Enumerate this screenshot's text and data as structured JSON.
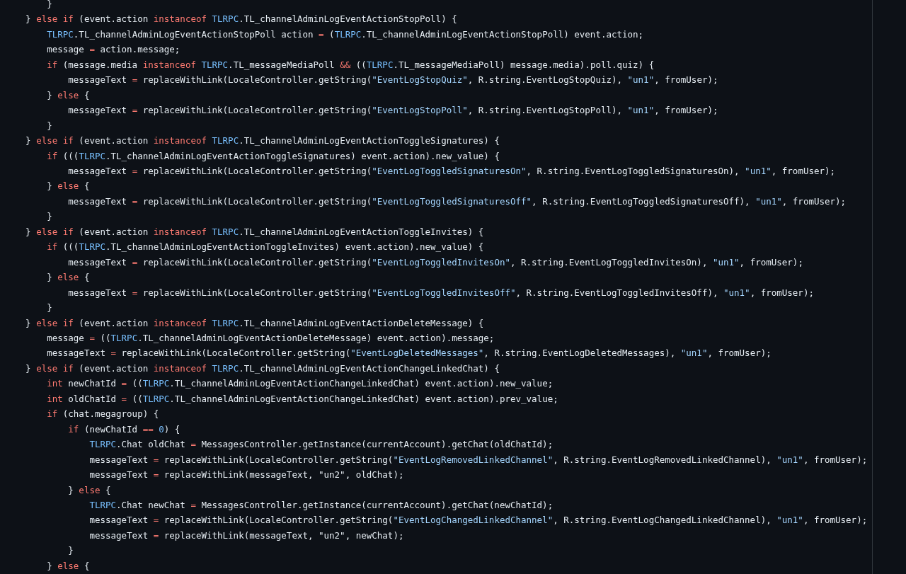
{
  "code": {
    "lines": [
      [
        {
          "text": "        }",
          "kind": "plain"
        }
      ],
      [
        {
          "text": "    } ",
          "kind": "plain"
        },
        {
          "text": "else",
          "kind": "keyword"
        },
        {
          "text": " if",
          "kind": "keyword"
        },
        {
          "text": " (event.action ",
          "kind": "plain"
        },
        {
          "text": "instanceof",
          "kind": "keyword"
        },
        {
          "text": " TLRPC",
          "kind": "type"
        },
        {
          "text": ".TL_channelAdminLogEventActionStopPoll) {",
          "kind": "plain"
        }
      ],
      [
        {
          "text": "        TLRPC",
          "kind": "type"
        },
        {
          "text": ".TL_channelAdminLogEventActionStopPoll action ",
          "kind": "plain"
        },
        {
          "text": "=",
          "kind": "operator"
        },
        {
          "text": " (",
          "kind": "plain"
        },
        {
          "text": "TLRPC",
          "kind": "type"
        },
        {
          "text": ".TL_channelAdminLogEventActionStopPoll) event.action;",
          "kind": "plain"
        }
      ],
      [
        {
          "text": "        message ",
          "kind": "plain"
        },
        {
          "text": "=",
          "kind": "operator"
        },
        {
          "text": " action.message;",
          "kind": "plain"
        }
      ],
      [
        {
          "text": "        if",
          "kind": "keyword"
        },
        {
          "text": " (message.media ",
          "kind": "plain"
        },
        {
          "text": "instanceof",
          "kind": "keyword"
        },
        {
          "text": " TLRPC",
          "kind": "type"
        },
        {
          "text": ".TL_messageMediaPoll ",
          "kind": "plain"
        },
        {
          "text": "&&",
          "kind": "operator"
        },
        {
          "text": " ((",
          "kind": "plain"
        },
        {
          "text": "TLRPC",
          "kind": "type"
        },
        {
          "text": ".TL_messageMediaPoll) message.media).poll.quiz) {",
          "kind": "plain"
        }
      ],
      [
        {
          "text": "            messageText ",
          "kind": "plain"
        },
        {
          "text": "=",
          "kind": "operator"
        },
        {
          "text": " replaceWithLink(LocaleController.getString(",
          "kind": "plain"
        },
        {
          "text": "\"EventLogStopQuiz\"",
          "kind": "string"
        },
        {
          "text": ", R.string.EventLogStopQuiz), ",
          "kind": "plain"
        },
        {
          "text": "\"un1\"",
          "kind": "string"
        },
        {
          "text": ", fromUser);",
          "kind": "plain"
        }
      ],
      [
        {
          "text": "        } ",
          "kind": "plain"
        },
        {
          "text": "else",
          "kind": "keyword"
        },
        {
          "text": " {",
          "kind": "plain"
        }
      ],
      [
        {
          "text": "            messageText ",
          "kind": "plain"
        },
        {
          "text": "=",
          "kind": "operator"
        },
        {
          "text": " replaceWithLink(LocaleController.getString(",
          "kind": "plain"
        },
        {
          "text": "\"EventLogStopPoll\"",
          "kind": "string"
        },
        {
          "text": ", R.string.EventLogStopPoll), ",
          "kind": "plain"
        },
        {
          "text": "\"un1\"",
          "kind": "string"
        },
        {
          "text": ", fromUser);",
          "kind": "plain"
        }
      ],
      [
        {
          "text": "        }",
          "kind": "plain"
        }
      ],
      [
        {
          "text": "    } ",
          "kind": "plain"
        },
        {
          "text": "else",
          "kind": "keyword"
        },
        {
          "text": " if",
          "kind": "keyword"
        },
        {
          "text": " (event.action ",
          "kind": "plain"
        },
        {
          "text": "instanceof",
          "kind": "keyword"
        },
        {
          "text": " TLRPC",
          "kind": "type"
        },
        {
          "text": ".TL_channelAdminLogEventActionToggleSignatures) {",
          "kind": "plain"
        }
      ],
      [
        {
          "text": "        if",
          "kind": "keyword"
        },
        {
          "text": " (((",
          "kind": "plain"
        },
        {
          "text": "TLRPC",
          "kind": "type"
        },
        {
          "text": ".TL_channelAdminLogEventActionToggleSignatures) event.action).new_value) {",
          "kind": "plain"
        }
      ],
      [
        {
          "text": "            messageText ",
          "kind": "plain"
        },
        {
          "text": "=",
          "kind": "operator"
        },
        {
          "text": " replaceWithLink(LocaleController.getString(",
          "kind": "plain"
        },
        {
          "text": "\"EventLogToggledSignaturesOn\"",
          "kind": "string"
        },
        {
          "text": ", R.string.EventLogToggledSignaturesOn), ",
          "kind": "plain"
        },
        {
          "text": "\"un1\"",
          "kind": "string"
        },
        {
          "text": ", fromUser);",
          "kind": "plain"
        }
      ],
      [
        {
          "text": "        } ",
          "kind": "plain"
        },
        {
          "text": "else",
          "kind": "keyword"
        },
        {
          "text": " {",
          "kind": "plain"
        }
      ],
      [
        {
          "text": "            messageText ",
          "kind": "plain"
        },
        {
          "text": "=",
          "kind": "operator"
        },
        {
          "text": " replaceWithLink(LocaleController.getString(",
          "kind": "plain"
        },
        {
          "text": "\"EventLogToggledSignaturesOff\"",
          "kind": "string"
        },
        {
          "text": ", R.string.EventLogToggledSignaturesOff), ",
          "kind": "plain"
        },
        {
          "text": "\"un1\"",
          "kind": "string"
        },
        {
          "text": ", fromUser);",
          "kind": "plain"
        }
      ],
      [
        {
          "text": "        }",
          "kind": "plain"
        }
      ],
      [
        {
          "text": "    } ",
          "kind": "plain"
        },
        {
          "text": "else",
          "kind": "keyword"
        },
        {
          "text": " if",
          "kind": "keyword"
        },
        {
          "text": " (event.action ",
          "kind": "plain"
        },
        {
          "text": "instanceof",
          "kind": "keyword"
        },
        {
          "text": " TLRPC",
          "kind": "type"
        },
        {
          "text": ".TL_channelAdminLogEventActionToggleInvites) {",
          "kind": "plain"
        }
      ],
      [
        {
          "text": "        if",
          "kind": "keyword"
        },
        {
          "text": " (((",
          "kind": "plain"
        },
        {
          "text": "TLRPC",
          "kind": "type"
        },
        {
          "text": ".TL_channelAdminLogEventActionToggleInvites) event.action).new_value) {",
          "kind": "plain"
        }
      ],
      [
        {
          "text": "            messageText ",
          "kind": "plain"
        },
        {
          "text": "=",
          "kind": "operator"
        },
        {
          "text": " replaceWithLink(LocaleController.getString(",
          "kind": "plain"
        },
        {
          "text": "\"EventLogToggledInvitesOn\"",
          "kind": "string"
        },
        {
          "text": ", R.string.EventLogToggledInvitesOn), ",
          "kind": "plain"
        },
        {
          "text": "\"un1\"",
          "kind": "string"
        },
        {
          "text": ", fromUser);",
          "kind": "plain"
        }
      ],
      [
        {
          "text": "        } ",
          "kind": "plain"
        },
        {
          "text": "else",
          "kind": "keyword"
        },
        {
          "text": " {",
          "kind": "plain"
        }
      ],
      [
        {
          "text": "            messageText ",
          "kind": "plain"
        },
        {
          "text": "=",
          "kind": "operator"
        },
        {
          "text": " replaceWithLink(LocaleController.getString(",
          "kind": "plain"
        },
        {
          "text": "\"EventLogToggledInvitesOff\"",
          "kind": "string"
        },
        {
          "text": ", R.string.EventLogToggledInvitesOff), ",
          "kind": "plain"
        },
        {
          "text": "\"un1\"",
          "kind": "string"
        },
        {
          "text": ", fromUser);",
          "kind": "plain"
        }
      ],
      [
        {
          "text": "        }",
          "kind": "plain"
        }
      ],
      [
        {
          "text": "    } ",
          "kind": "plain"
        },
        {
          "text": "else",
          "kind": "keyword"
        },
        {
          "text": " if",
          "kind": "keyword"
        },
        {
          "text": " (event.action ",
          "kind": "plain"
        },
        {
          "text": "instanceof",
          "kind": "keyword"
        },
        {
          "text": " TLRPC",
          "kind": "type"
        },
        {
          "text": ".TL_channelAdminLogEventActionDeleteMessage) {",
          "kind": "plain"
        }
      ],
      [
        {
          "text": "        message ",
          "kind": "plain"
        },
        {
          "text": "=",
          "kind": "operator"
        },
        {
          "text": " ((",
          "kind": "plain"
        },
        {
          "text": "TLRPC",
          "kind": "type"
        },
        {
          "text": ".TL_channelAdminLogEventActionDeleteMessage) event.action).message;",
          "kind": "plain"
        }
      ],
      [
        {
          "text": "        messageText ",
          "kind": "plain"
        },
        {
          "text": "=",
          "kind": "operator"
        },
        {
          "text": " replaceWithLink(LocaleController.getString(",
          "kind": "plain"
        },
        {
          "text": "\"EventLogDeletedMessages\"",
          "kind": "string"
        },
        {
          "text": ", R.string.EventLogDeletedMessages), ",
          "kind": "plain"
        },
        {
          "text": "\"un1\"",
          "kind": "string"
        },
        {
          "text": ", fromUser);",
          "kind": "plain"
        }
      ],
      [
        {
          "text": "    } ",
          "kind": "plain"
        },
        {
          "text": "else",
          "kind": "keyword"
        },
        {
          "text": " if",
          "kind": "keyword"
        },
        {
          "text": " (event.action ",
          "kind": "plain"
        },
        {
          "text": "instanceof",
          "kind": "keyword"
        },
        {
          "text": " TLRPC",
          "kind": "type"
        },
        {
          "text": ".TL_channelAdminLogEventActionChangeLinkedChat) {",
          "kind": "plain"
        }
      ],
      [
        {
          "text": "        int",
          "kind": "keyword"
        },
        {
          "text": " newChatId ",
          "kind": "plain"
        },
        {
          "text": "=",
          "kind": "operator"
        },
        {
          "text": " ((",
          "kind": "plain"
        },
        {
          "text": "TLRPC",
          "kind": "type"
        },
        {
          "text": ".TL_channelAdminLogEventActionChangeLinkedChat) event.action).new_value;",
          "kind": "plain"
        }
      ],
      [
        {
          "text": "        int",
          "kind": "keyword"
        },
        {
          "text": " oldChatId ",
          "kind": "plain"
        },
        {
          "text": "=",
          "kind": "operator"
        },
        {
          "text": " ((",
          "kind": "plain"
        },
        {
          "text": "TLRPC",
          "kind": "type"
        },
        {
          "text": ".TL_channelAdminLogEventActionChangeLinkedChat) event.action).prev_value;",
          "kind": "plain"
        }
      ],
      [
        {
          "text": "        if",
          "kind": "keyword"
        },
        {
          "text": " (chat.megagroup) {",
          "kind": "plain"
        }
      ],
      [
        {
          "text": "            if",
          "kind": "keyword"
        },
        {
          "text": " (newChatId ",
          "kind": "plain"
        },
        {
          "text": "==",
          "kind": "operator"
        },
        {
          "text": " 0",
          "kind": "number"
        },
        {
          "text": ") {",
          "kind": "plain"
        }
      ],
      [
        {
          "text": "                TLRPC",
          "kind": "type"
        },
        {
          "text": ".Chat oldChat ",
          "kind": "plain"
        },
        {
          "text": "=",
          "kind": "operator"
        },
        {
          "text": " MessagesController.getInstance(currentAccount).getChat(oldChatId);",
          "kind": "plain"
        }
      ],
      [
        {
          "text": "                messageText ",
          "kind": "plain"
        },
        {
          "text": "=",
          "kind": "operator"
        },
        {
          "text": " replaceWithLink(LocaleController.getString(",
          "kind": "plain"
        },
        {
          "text": "\"EventLogRemovedLinkedChannel\"",
          "kind": "string"
        },
        {
          "text": ", R.string.EventLogRemovedLinkedChannel), ",
          "kind": "plain"
        },
        {
          "text": "\"un1\"",
          "kind": "string"
        },
        {
          "text": ", fromUser);",
          "kind": "plain"
        }
      ],
      [
        {
          "text": "                messageText ",
          "kind": "plain"
        },
        {
          "text": "=",
          "kind": "operator"
        },
        {
          "text": " replaceWithLink(messageText, \"un2\", oldChat);",
          "kind": "plain"
        }
      ],
      [
        {
          "text": "            } ",
          "kind": "plain"
        },
        {
          "text": "else",
          "kind": "keyword"
        },
        {
          "text": " {",
          "kind": "plain"
        }
      ],
      [
        {
          "text": "                TLRPC",
          "kind": "type"
        },
        {
          "text": ".Chat newChat ",
          "kind": "plain"
        },
        {
          "text": "=",
          "kind": "operator"
        },
        {
          "text": " MessagesController.getInstance(currentAccount).getChat(newChatId);",
          "kind": "plain"
        }
      ],
      [
        {
          "text": "                messageText ",
          "kind": "plain"
        },
        {
          "text": "=",
          "kind": "operator"
        },
        {
          "text": " replaceWithLink(LocaleController.getString(",
          "kind": "plain"
        },
        {
          "text": "\"EventLogChangedLinkedChannel\"",
          "kind": "string"
        },
        {
          "text": ", R.string.EventLogChangedLinkedChannel), ",
          "kind": "plain"
        },
        {
          "text": "\"un1\"",
          "kind": "string"
        },
        {
          "text": ", fromUser);",
          "kind": "plain"
        }
      ],
      [
        {
          "text": "                messageText ",
          "kind": "plain"
        },
        {
          "text": "=",
          "kind": "operator"
        },
        {
          "text": " replaceWithLink(messageText, \"un2\", newChat);",
          "kind": "plain"
        }
      ],
      [
        {
          "text": "            }",
          "kind": "plain"
        }
      ],
      [
        {
          "text": "        } ",
          "kind": "plain"
        },
        {
          "text": "else",
          "kind": "keyword"
        },
        {
          "text": " {",
          "kind": "plain"
        }
      ]
    ]
  }
}
